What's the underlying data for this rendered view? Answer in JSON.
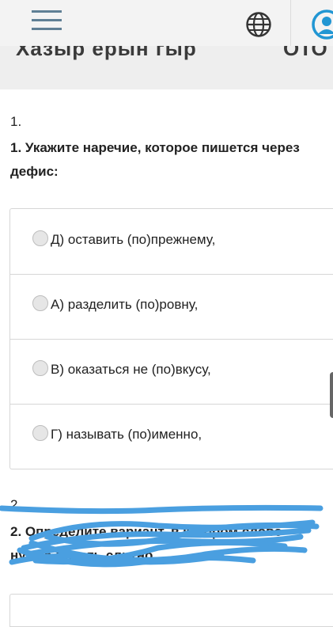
{
  "header": {
    "menu_icon": "hamburger-menu-icon",
    "language_icon": "globe-icon",
    "account_icon": "user-avatar-icon",
    "accent_color": "#5f7f95",
    "avatar_color": "#2196d3"
  },
  "subheader": {
    "title_fragment": "Xазыр ерын гыр",
    "title_fragment_right": "ОТО"
  },
  "question1": {
    "number": "1.",
    "text": "1. Укажите наречие, которое пишется через дефис:",
    "options": [
      {
        "label": "Д) оставить (по)прежнему,"
      },
      {
        "label": "А) разделить (по)ровну,"
      },
      {
        "label": "В) оказаться не (по)вкусу,"
      },
      {
        "label": "Г) называть (по)именно,"
      }
    ]
  },
  "question2": {
    "number": "2.",
    "text": "2. Определите вариант, в котором слово",
    "text_line2": "нужно писать слитно"
  },
  "annotation": {
    "scribble_color": "#4a9fe0"
  }
}
